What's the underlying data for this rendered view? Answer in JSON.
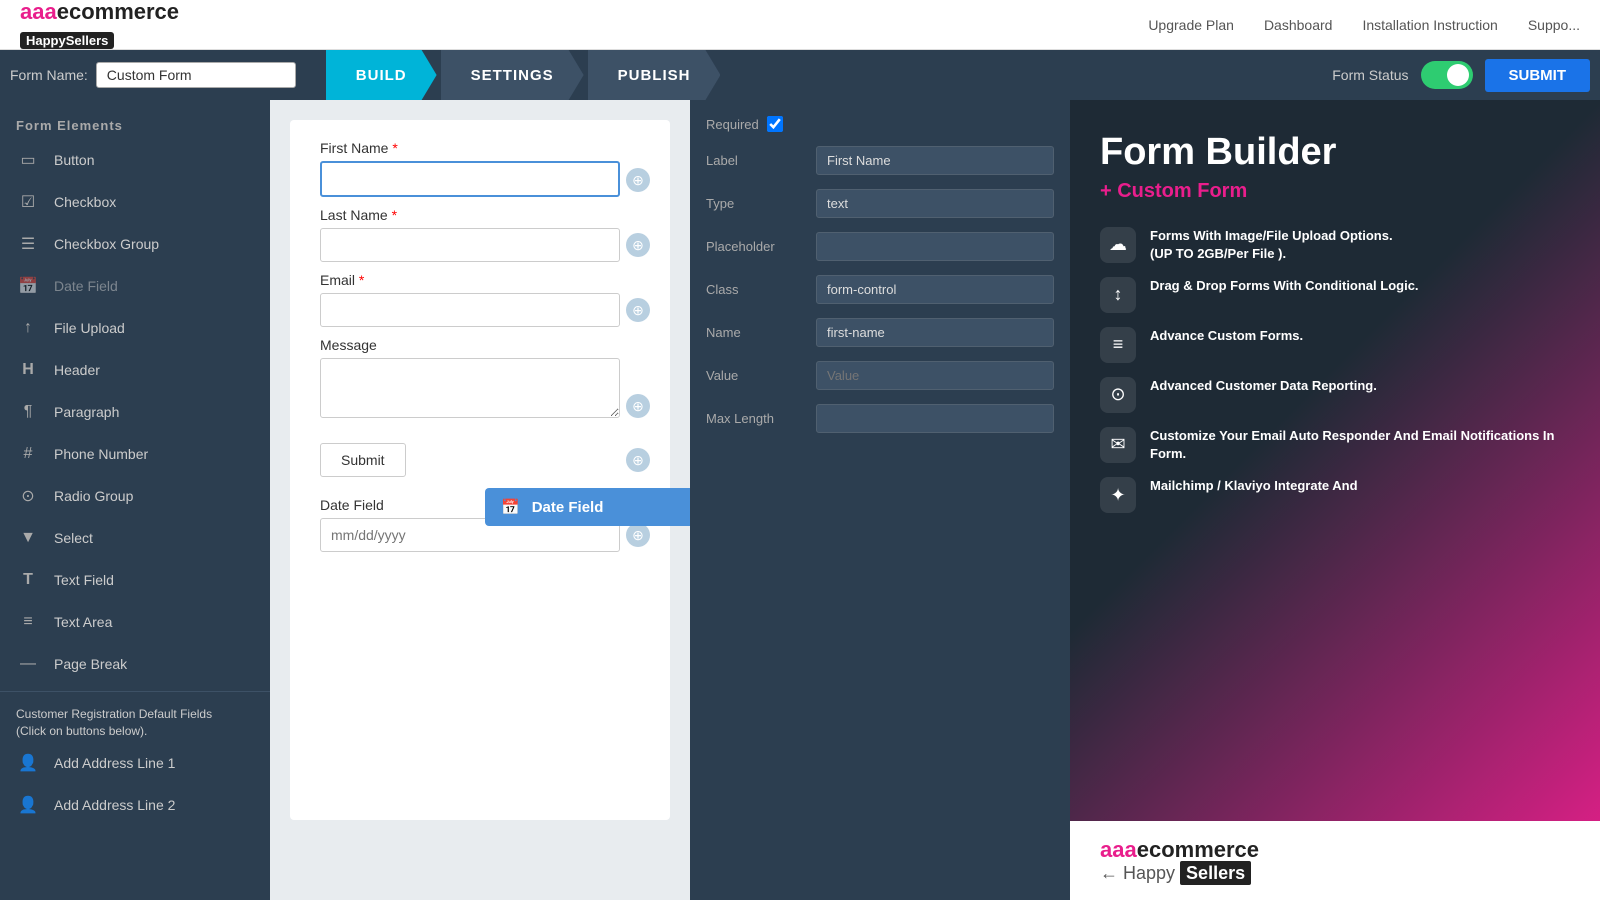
{
  "topnav": {
    "logo": "aaaecommerce",
    "logo_sub": "HappySellers",
    "links": [
      "Upgrade Plan",
      "Dashboard",
      "Installation Instruction",
      "Suppo..."
    ]
  },
  "formbar": {
    "form_name_label": "Form Name:",
    "form_name_value": "Custom Form",
    "tabs": [
      {
        "label": "BUILD",
        "active": true
      },
      {
        "label": "SETTINGS",
        "active": false
      },
      {
        "label": "PUBLISH",
        "active": false
      }
    ],
    "form_status_label": "Form Status",
    "submit_label": "SUBMIT"
  },
  "sidebar": {
    "title": "Form Elements",
    "items": [
      {
        "icon": "▭",
        "label": "Button"
      },
      {
        "icon": "☑",
        "label": "Checkbox"
      },
      {
        "icon": "☰",
        "label": "Checkbox Group"
      },
      {
        "icon": "📅",
        "label": "Date Field",
        "greyed": true
      },
      {
        "icon": "↑",
        "label": "File Upload"
      },
      {
        "icon": "H",
        "label": "Header"
      },
      {
        "icon": "¶",
        "label": "Paragraph"
      },
      {
        "icon": "#",
        "label": "Phone Number"
      },
      {
        "icon": "☰",
        "label": "Radio Group"
      },
      {
        "icon": "▼",
        "label": "Select"
      },
      {
        "icon": "T",
        "label": "Text Field"
      },
      {
        "icon": "≡",
        "label": "Text Area"
      },
      {
        "icon": "—",
        "label": "Page Break"
      }
    ],
    "customer_reg_title": "Customer Registration Default Fields",
    "customer_reg_sub": "(Click on buttons below).",
    "customer_reg_items": [
      {
        "icon": "👤",
        "label": "Add Address Line 1"
      },
      {
        "icon": "👤",
        "label": "Add Address Line 2"
      }
    ]
  },
  "form_canvas": {
    "fields": [
      {
        "type": "text",
        "label": "First Name",
        "required": true,
        "placeholder": "",
        "active": true
      },
      {
        "type": "text",
        "label": "Last Name",
        "required": true,
        "placeholder": ""
      },
      {
        "type": "text",
        "label": "Email",
        "required": true,
        "placeholder": ""
      },
      {
        "type": "textarea",
        "label": "Message",
        "required": false,
        "placeholder": ""
      },
      {
        "type": "submit",
        "label": "Submit"
      },
      {
        "type": "date",
        "label": "Date Field",
        "placeholder": "mm/dd/yyyy"
      }
    ],
    "drag_overlay": {
      "label": "Date Field",
      "icon": "📅"
    }
  },
  "properties": {
    "required_label": "Required",
    "label_label": "Label",
    "label_value": "First Name",
    "type_label": "Type",
    "type_value": "text",
    "placeholder_label": "Placeholder",
    "placeholder_value": "",
    "class_label": "Class",
    "class_value": "form-control",
    "name_label": "Name",
    "name_value": "first-name",
    "value_label": "Value",
    "value_placeholder": "Value",
    "maxlength_label": "Max Length",
    "maxlength_value": ""
  },
  "promo": {
    "title_prefix": "Form Builder",
    "title_highlight": "Form Builder",
    "subtitle": "+ Custom Form",
    "features": [
      {
        "icon": "☁",
        "text": "Forms With Image/File Upload Options.\n(UP TO 2GB/Per File )."
      },
      {
        "icon": "↕",
        "text": "Drag & Drop Forms With Conditional Logic."
      },
      {
        "icon": "≡",
        "text": "Advance Custom Forms."
      },
      {
        "icon": "⊙",
        "text": "Advanced Customer Data Reporting."
      },
      {
        "icon": "✉",
        "text": "Customize Your Email Auto Responder And Email Notifications In Form."
      },
      {
        "icon": "✦",
        "text": "Mailchimp / Klaviyo Integrate And"
      }
    ],
    "logo": "aaaecommerce",
    "logo_tagline_prefix": "Happy",
    "logo_tagline_suffix": "Sellers"
  }
}
